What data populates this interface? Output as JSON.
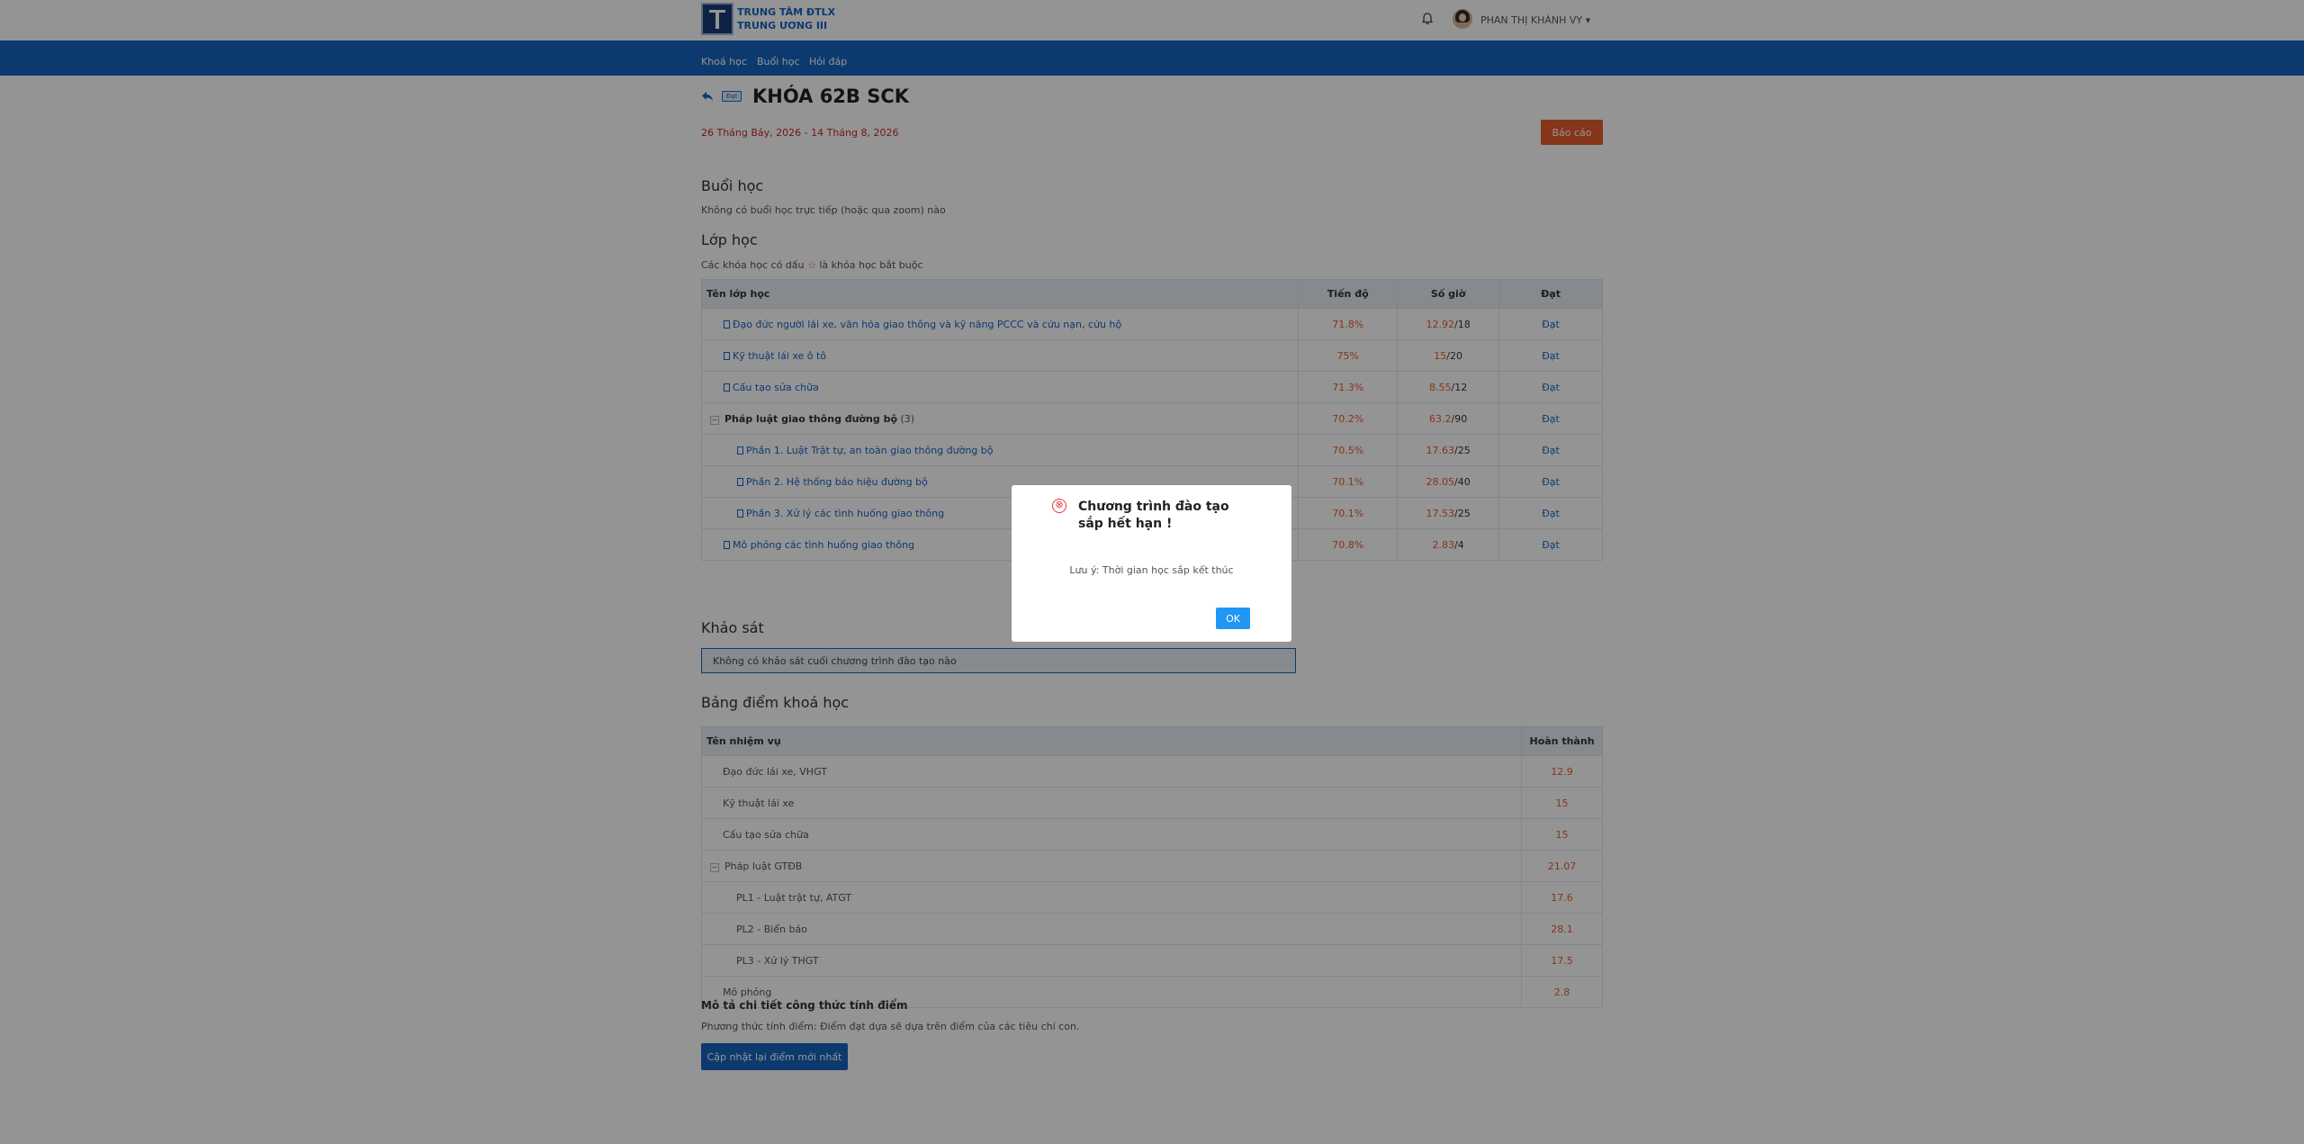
{
  "header": {
    "logo_text": "TRUNG TÂM ĐTLX TRUNG ƯƠNG III",
    "username": "PHAN THỊ KHÁNH VY ▾"
  },
  "nav": [
    "Khoá học",
    "Buổi học",
    "Hỏi đáp"
  ],
  "course": {
    "badge": "Đạt",
    "title": "KHÓA 62B SCK",
    "dates": "26 Tháng Bảy, 2026 - 14 Tháng 8, 2026",
    "report_label": "Báo cáo"
  },
  "sessions": {
    "heading": "Buổi học",
    "empty": "Không có buổi học trực tiếp (hoặc qua zoom) nào"
  },
  "classes": {
    "heading": "Lớp học",
    "note_before": "Các khóa học có dấu",
    "star": "☆",
    "note_after": "là khóa học bắt buộc",
    "columns": [
      "Tên lớp học",
      "Tiến độ",
      "Số giờ",
      "Đạt"
    ],
    "rows": [
      {
        "name": "Đạo đức người lái xe, văn hóa giao thông và kỹ năng PCCC và cứu nạn, cứu hộ",
        "progress": "71.8%",
        "hours": "12.92",
        "total": "/18",
        "status": "Đạt"
      },
      {
        "name": "Kỹ thuật lái xe ô tô",
        "progress": "75%",
        "hours": "15",
        "total": "/20",
        "status": "Đạt"
      },
      {
        "name": "Cấu tạo sửa chữa",
        "progress": "71.3%",
        "hours": "8.55",
        "total": "/12",
        "status": "Đạt"
      },
      {
        "name": "Pháp luật giao thông đường bộ",
        "count": "(3)",
        "progress": "70.2%",
        "hours": "63.2",
        "total": "/90",
        "status": "Đạt"
      },
      {
        "name": "Phần 1. Luật Trật tự, an toàn giao thông đường bộ",
        "progress": "70.5%",
        "hours": "17.63",
        "total": "/25",
        "status": "Đạt"
      },
      {
        "name": "Phần 2. Hệ thống báo hiệu đường bộ",
        "progress": "70.1%",
        "hours": "28.05",
        "total": "/40",
        "status": "Đạt"
      },
      {
        "name": "Phần 3. Xử lý các tình huống giao thông",
        "progress": "70.1%",
        "hours": "17.53",
        "total": "/25",
        "status": "Đạt"
      },
      {
        "name": "Mô phỏng các tình huống giao thông",
        "progress": "70.8%",
        "hours": "2.83",
        "total": "/4",
        "status": "Đạt"
      }
    ]
  },
  "survey": {
    "heading": "Khảo sát",
    "empty": "Không có khảo sát cuối chương trình đào tạo nào"
  },
  "scores": {
    "heading": "Bảng điểm khoá học",
    "columns": [
      "Tên nhiệm vụ",
      "Hoàn thành"
    ],
    "rows": [
      {
        "name": "Đạo đức lái xe, VHGT",
        "value": "12.9"
      },
      {
        "name": "Kỹ thuật lái xe",
        "value": "15"
      },
      {
        "name": "Cấu tạo sửa chữa",
        "value": "15"
      },
      {
        "name": "Pháp luật GTĐB",
        "value": "21.07"
      },
      {
        "name": "PL1 - Luật trật tự, ATGT",
        "value": "17.6"
      },
      {
        "name": "PL2 - Biển báo",
        "value": "28.1"
      },
      {
        "name": "PL3 - Xử lý THGT",
        "value": "17.5"
      },
      {
        "name": "Mô phỏng",
        "value": "2.8"
      }
    ]
  },
  "formula": {
    "heading": "Mô tả chi tiết công thức tính điểm",
    "text": "Phương thức tính điểm: Điểm đạt dựa sẽ dựa trên điểm của các tiêu chí con.",
    "update_label": "Cập nhật lại điểm mới nhất"
  },
  "modal": {
    "title": "Chương trình đào tạo sắp hết hạn !",
    "message": "Lưu ý: Thời gian học sắp kết thúc",
    "ok_label": "OK",
    "icon": "⊗"
  }
}
